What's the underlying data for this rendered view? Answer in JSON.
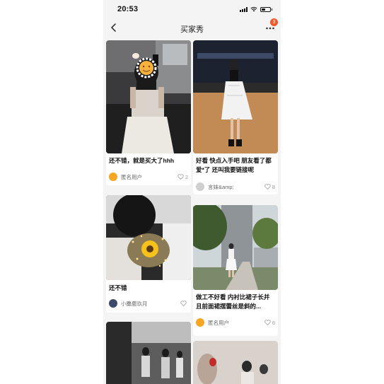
{
  "status_bar": {
    "time": "20:53",
    "battery_level": 0.45
  },
  "nav": {
    "title": "买家秀",
    "badge_count": "3",
    "back_icon": "chevron-left-icon",
    "more_icon": "more-dots-icon"
  },
  "posts": [
    {
      "title": "还不错，就是买大了hhh",
      "user": "匿名用户",
      "likes": "2"
    },
    {
      "title": "好看 快点入手吧 朋友看了都爱*了 还叫我要链接呢",
      "user": "言妹&amp;",
      "likes": "8"
    },
    {
      "title": "还不错",
      "user": "小麋鹿玖月",
      "likes": ""
    },
    {
      "title": "做工不好看 内衬比裙子长并且前面裙摆蕾丝是斜的...",
      "user": "匿名用户",
      "likes": "6"
    },
    {
      "title": "",
      "user": "",
      "likes": ""
    },
    {
      "title": "",
      "user": "",
      "likes": ""
    }
  ],
  "colors": {
    "badge": "#ef5a2a",
    "page_bg": "#f4f4f4",
    "card_bg": "#ffffff"
  }
}
